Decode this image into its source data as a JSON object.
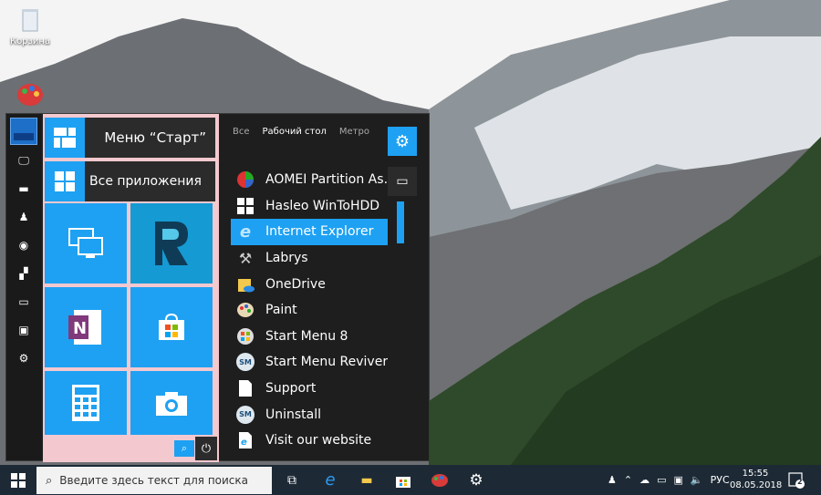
{
  "desktop": {
    "recycle_bin_label": "Корзина"
  },
  "start_menu": {
    "header_title": "Меню “Старт”",
    "all_apps_label": "Все приложения",
    "tabs": [
      {
        "label": "Все",
        "active": false
      },
      {
        "label": "Рабочий стол",
        "active": true
      },
      {
        "label": "Метро",
        "active": false
      }
    ],
    "apps": [
      {
        "label": "AOMEI Partition As…",
        "icon": "aomei-icon",
        "highlighted": false
      },
      {
        "label": "Hasleo WinToHDD",
        "icon": "windows-icon",
        "highlighted": false
      },
      {
        "label": "Internet Explorer",
        "icon": "internet-explorer-icon",
        "highlighted": true
      },
      {
        "label": "Labrys",
        "icon": "labrys-icon",
        "highlighted": false
      },
      {
        "label": "OneDrive",
        "icon": "onedrive-icon",
        "highlighted": false
      },
      {
        "label": "Paint",
        "icon": "paint-icon",
        "highlighted": false
      },
      {
        "label": "Start Menu 8",
        "icon": "start-menu-8-icon",
        "highlighted": false
      },
      {
        "label": "Start Menu Reviver",
        "icon": "sm-icon",
        "highlighted": false
      },
      {
        "label": "Support",
        "icon": "document-icon",
        "highlighted": false
      },
      {
        "label": "Uninstall",
        "icon": "sm-icon",
        "highlighted": false
      },
      {
        "label": "Visit our website",
        "icon": "web-icon",
        "highlighted": false
      }
    ],
    "accent_color": "#1ea1f2",
    "highlight_color": "#f4c8cf"
  },
  "taskbar": {
    "search_placeholder": "Введите здесь текст для поиска",
    "language": "РУС",
    "time": "15:55",
    "date": "08.05.2018",
    "notification_count": "2"
  }
}
